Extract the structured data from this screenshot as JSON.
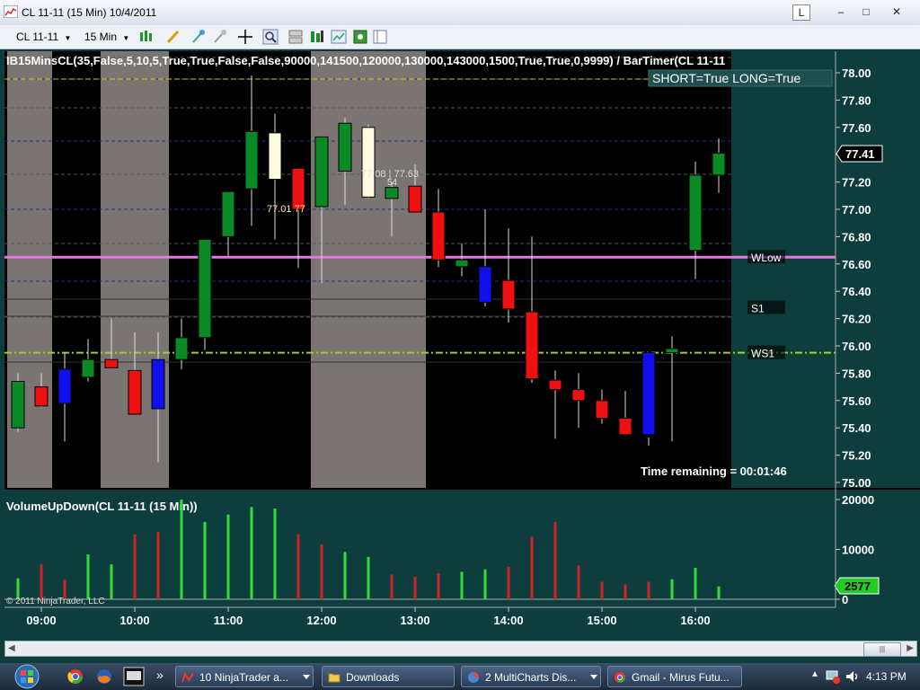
{
  "window": {
    "title": "CL 11-11 (15 Min)  10/4/2011",
    "controls": [
      "L",
      "–",
      "□",
      "✕"
    ]
  },
  "toolbar": {
    "instrument": "CL 11-11",
    "interval": "15 Min",
    "icons": [
      "bar-type-icon",
      "pencil-draw-icon",
      "marker-icon",
      "eraser-icon",
      "crosshair-icon",
      "zoom-icon",
      "split-panels-icon",
      "strategy-icon",
      "chart-properties-icon",
      "data-box-icon",
      "tabs-icon"
    ]
  },
  "price_panel": {
    "indicator_label": "IB15MinsCL(35,False,5,10,5,True,True,False,False,90000,141500,120000,130000,143000,1500,True,True,0,9999)  /  BarTimer(CL  11-11",
    "status_label": "SHORT=True LONG=True",
    "last_price": "77.41",
    "time_remaining": "Time remaining = 00:01:46",
    "level_labels": [
      "WLow",
      "S1",
      "WS1"
    ],
    "bar_annotations": [
      "77.01  77",
      "77.08 | 77.63",
      "54"
    ],
    "y_ticks": [
      "78.00",
      "77.80",
      "77.60",
      "77.40",
      "77.20",
      "77.00",
      "76.80",
      "76.60",
      "76.40",
      "76.20",
      "76.00",
      "75.80",
      "75.60",
      "75.40",
      "75.20",
      "75.00"
    ]
  },
  "volume_panel": {
    "title": "VolumeUpDown(CL 11-11 (15 Min))",
    "y_ticks": [
      "20000",
      "10000",
      "0"
    ],
    "last_volume": "2577",
    "copyright": "© 2011 NinjaTrader, LLC"
  },
  "x_ticks": [
    "09:00",
    "10:00",
    "11:00",
    "12:00",
    "13:00",
    "14:00",
    "15:00",
    "16:00"
  ],
  "colors": {
    "background": "#0e3d3d",
    "chart_bg": "#000000",
    "session_shade": "#7a7572",
    "up_bar": "#0a8a24",
    "down_bar": "#ee1111",
    "blue_bar": "#1010ee",
    "cream_bar": "#fffbe0",
    "pivot_line": "#e07adc",
    "ws1_line": "#9fd21e",
    "vol_up": "#33dd33",
    "vol_down": "#cc2222"
  },
  "chart_data": {
    "type": "candlestick",
    "x": [
      "08:45",
      "09:00",
      "09:15",
      "09:30",
      "09:45",
      "10:00",
      "10:15",
      "10:30",
      "10:45",
      "11:00",
      "11:15",
      "11:30",
      "11:45",
      "12:00",
      "12:15",
      "12:30",
      "12:45",
      "13:00",
      "13:15",
      "13:30",
      "13:45",
      "14:00",
      "14:15",
      "14:30",
      "14:45",
      "15:00",
      "15:15",
      "15:30",
      "15:45",
      "16:00",
      "16:15"
    ],
    "open": [
      75.4,
      75.7,
      75.58,
      75.9,
      75.9,
      75.82,
      75.54,
      75.9,
      76.06,
      76.8,
      77.15,
      77.56,
      77.3,
      77.02,
      77.28,
      77.6,
      77.08,
      77.17,
      76.98,
      76.63,
      76.58,
      76.48,
      76.25,
      75.75,
      75.68,
      75.6,
      75.47,
      75.35,
      75.95,
      76.7,
      77.25
    ],
    "high": [
      75.8,
      75.8,
      75.95,
      76.05,
      76.2,
      76.1,
      76.1,
      76.2,
      76.42,
      77.02,
      77.98,
      77.7,
      77.05,
      77.32,
      77.67,
      77.62,
      77.2,
      77.33,
      77.15,
      76.75,
      77.0,
      76.86,
      76.8,
      75.82,
      75.8,
      75.68,
      75.67,
      75.33,
      76.07,
      77.35,
      77.52
    ],
    "low": [
      75.37,
      75.55,
      75.3,
      75.74,
      75.86,
      75.52,
      75.15,
      75.83,
      75.97,
      76.66,
      76.88,
      76.78,
      76.57,
      76.46,
      77.03,
      77.08,
      76.8,
      76.99,
      76.58,
      76.51,
      76.29,
      76.17,
      75.73,
      75.32,
      75.4,
      75.43,
      75.39,
      75.27,
      75.3,
      76.49,
      77.12
    ],
    "close": [
      75.74,
      75.56,
      75.83,
      75.77,
      75.84,
      75.5,
      75.9,
      76.06,
      76.78,
      77.13,
      77.57,
      77.22,
      77.0,
      77.53,
      77.63,
      77.09,
      77.16,
      76.98,
      76.63,
      76.58,
      76.32,
      76.27,
      75.76,
      75.68,
      75.6,
      75.47,
      75.35,
      75.95,
      75.98,
      77.25,
      77.41
    ],
    "style": [
      "up",
      "down",
      "blue",
      "up",
      "down",
      "down",
      "blue",
      "up",
      "up",
      "up",
      "up",
      "cream",
      "down",
      "up",
      "up",
      "cream",
      "up",
      "down",
      "down",
      "up",
      "blue",
      "down",
      "down",
      "down",
      "down",
      "down",
      "down",
      "blue",
      "up",
      "up",
      "up"
    ],
    "ylim": [
      75.0,
      78.05
    ],
    "levels": {
      "WLow": 76.65,
      "S1": 76.28,
      "WS1": 75.95
    },
    "volume": [
      4200,
      7000,
      4000,
      9000,
      7000,
      13000,
      13500,
      20000,
      15500,
      17000,
      18500,
      18200,
      13000,
      11000,
      9500,
      8500,
      5000,
      4500,
      5200,
      5500,
      6000,
      6500,
      12500,
      15500,
      6800,
      3500,
      3000,
      3500,
      4000,
      6300,
      2577
    ],
    "volume_up": [
      true,
      false,
      false,
      true,
      true,
      false,
      false,
      true,
      true,
      true,
      true,
      true,
      false,
      false,
      true,
      true,
      false,
      false,
      false,
      true,
      true,
      false,
      false,
      false,
      false,
      false,
      false,
      false,
      true,
      true,
      true
    ],
    "volume_ylim": [
      0,
      20000
    ],
    "session_shading": [
      [
        "08:45",
        "09:00"
      ],
      [
        "09:45",
        "10:15"
      ],
      [
        "12:00",
        "13:00"
      ]
    ]
  },
  "taskbar": {
    "items": [
      {
        "label": "10 NinjaTrader a...",
        "name": "ninjatrader-task"
      },
      {
        "label": "Downloads",
        "name": "downloads-task"
      },
      {
        "label": "2 MultiCharts Dis...",
        "name": "multicharts-task"
      },
      {
        "label": "Gmail - Mirus Futu...",
        "name": "gmail-task"
      }
    ],
    "clock": "4:13 PM"
  }
}
